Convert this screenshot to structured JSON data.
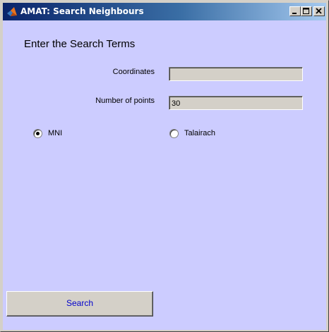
{
  "window": {
    "title": "AMAT: Search Neighbours",
    "app_icon": "matlab-icon",
    "controls": {
      "minimize_icon": "minimize-icon",
      "maximize_icon": "maximize-icon",
      "close_icon": "close-icon"
    }
  },
  "form": {
    "heading": "Enter the Search Terms",
    "coordinates": {
      "label": "Coordinates",
      "value": ""
    },
    "number_of_points": {
      "label": "Number of points",
      "value": "30"
    },
    "coordinate_system": {
      "options": [
        {
          "label": "MNI",
          "selected": true
        },
        {
          "label": "Talairach",
          "selected": false
        }
      ]
    },
    "search_button_label": "Search"
  },
  "colors": {
    "background": "#ccccff",
    "titlebar_start": "#0a246a",
    "titlebar_end": "#a6caf0",
    "button_text": "#0000cc"
  }
}
